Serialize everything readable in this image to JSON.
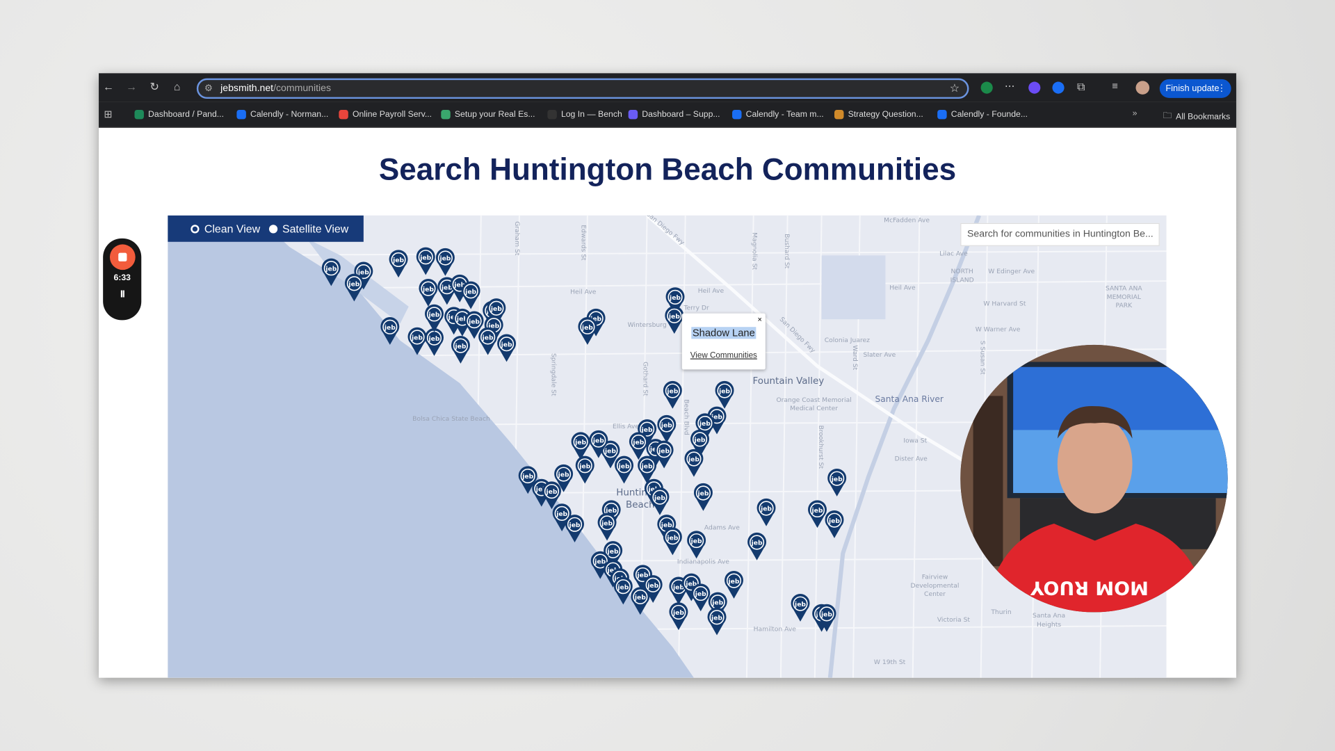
{
  "browser": {
    "url_domain": "jebsmith.net",
    "url_path": "/communities",
    "finish_update": "Finish update",
    "bookmarks": [
      {
        "label": "Dashboard / Pand...",
        "color": "#1e8a5a"
      },
      {
        "label": "Calendly - Norman...",
        "color": "#1a6ef5"
      },
      {
        "label": "Online Payroll Serv...",
        "color": "#e8453c"
      },
      {
        "label": "Setup your Real Es...",
        "color": "#3aa76d"
      },
      {
        "label": "Log In — Bench",
        "color": "#333333"
      },
      {
        "label": "Dashboard – Supp...",
        "color": "#6a5cf5"
      },
      {
        "label": "Calendly - Team m...",
        "color": "#1a6ef5"
      },
      {
        "label": "Strategy Question...",
        "color": "#d08a2a"
      },
      {
        "label": "Calendly - Founde...",
        "color": "#1a6ef5"
      }
    ],
    "all_bookmarks": "All Bookmarks"
  },
  "page": {
    "title": "Search Huntington Beach Communities",
    "view_toggle": {
      "clean": "Clean View",
      "satellite": "Satellite View",
      "selected": "satellite"
    },
    "search_placeholder": "Search for communities in Huntington Be...",
    "popup": {
      "name": "Shadow Lane",
      "link": "View Communities",
      "close": "×"
    },
    "marker_label": "jeb",
    "map_labels": [
      "McFadden Ave",
      "Heil Ave",
      "Heil Ave",
      "Heil Ave",
      "Terry Dr",
      "Wintersburg",
      "Colonia Juarez",
      "Slater Ave",
      "Fountain Valley",
      "Orange Coast Memorial",
      "Medical Center",
      "Santa Ana River",
      "Ellis Ave",
      "Huntin",
      "Beach",
      "Adams Ave",
      "Indianapolis Ave",
      "Hamilton Ave",
      "Victoria St",
      "W 19th St",
      "NORTH",
      "ISLAND",
      "W Edinger Ave",
      "W Harvard St",
      "W Warner Ave",
      "SANTA ANA",
      "MEMORIAL",
      "PARK",
      "Iowa St",
      "Dister Ave",
      "Fairview",
      "Developmental",
      "Center",
      "Thurin",
      "Santa Ana",
      "Heights",
      "Lilac Ave",
      "Bolsa Chica State Beach",
      "Graham St",
      "Edwards St",
      "Springdale St",
      "Gothard St",
      "Beach Blvd",
      "Magnolia St",
      "Bushard St",
      "Brookhurst St",
      "Ward St",
      "S Susan St",
      "San Diego Fwy",
      "San Diego Fwy"
    ],
    "colors": {
      "brand": "#173a79",
      "marker": "#133a6e",
      "title": "#13235b",
      "water": "#b9c8e2"
    }
  },
  "recorder": {
    "time": "6:33",
    "pause": "II"
  }
}
